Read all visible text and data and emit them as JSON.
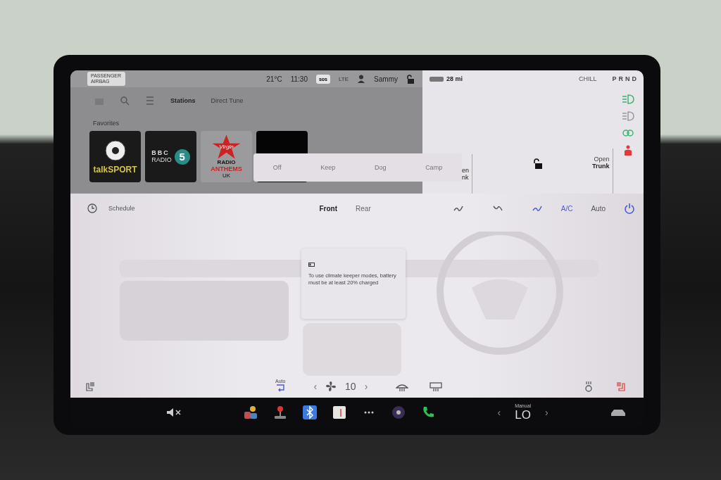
{
  "status_bar": {
    "airbag_label": "PASSENGER AIRBAG",
    "temperature": "21°C",
    "time": "11:30",
    "sos": "sos",
    "network": "LTE",
    "user": "Sammy",
    "range": "28 mi",
    "drive_mode": "CHILL",
    "gears": [
      "P",
      "R",
      "N",
      "D"
    ]
  },
  "media": {
    "tabs": [
      {
        "label": "Stations",
        "selected": true
      },
      {
        "label": "Direct Tune",
        "selected": false
      }
    ],
    "favorites_heading": "Favorites",
    "favorites": [
      {
        "kind": "talksport",
        "texts": [
          "talkSPORT"
        ]
      },
      {
        "kind": "bbc",
        "texts": [
          "BBC",
          "RADIO",
          "5"
        ]
      },
      {
        "kind": "virgin",
        "texts": [
          "Virgin",
          "RADIO",
          "ANTHEMS",
          "UK"
        ]
      },
      {
        "kind": "blank"
      }
    ]
  },
  "car": {
    "frunk_label": [
      "en",
      "nk"
    ],
    "trunk_label": [
      "Open",
      "Trunk"
    ],
    "locked": false
  },
  "climate_keeper": {
    "options": [
      {
        "label": "Off",
        "disabled": true
      },
      {
        "label": "Keep",
        "disabled": true
      },
      {
        "label": "Dog",
        "disabled": true
      },
      {
        "label": "Camp",
        "disabled": true
      }
    ]
  },
  "climate": {
    "schedule": "Schedule",
    "zones": [
      {
        "label": "Front",
        "selected": true
      },
      {
        "label": "Rear",
        "selected": false
      }
    ],
    "ac": {
      "label": "A/C",
      "on": true
    },
    "auto": {
      "label": "Auto",
      "on": false
    },
    "power_on": true,
    "message": "To use climate keeper modes, battery must be at least 20% charged",
    "recirc_label": "Auto",
    "fan_prev": "‹",
    "fan_speed": "10",
    "fan_next": "›",
    "driver_seat_heat_on": false,
    "passenger_seat_heat_on": true
  },
  "dock": {
    "temp_prev": "‹",
    "temp_next": "›",
    "temp_mode": "Manual",
    "temperature": "LO",
    "muted": true
  }
}
